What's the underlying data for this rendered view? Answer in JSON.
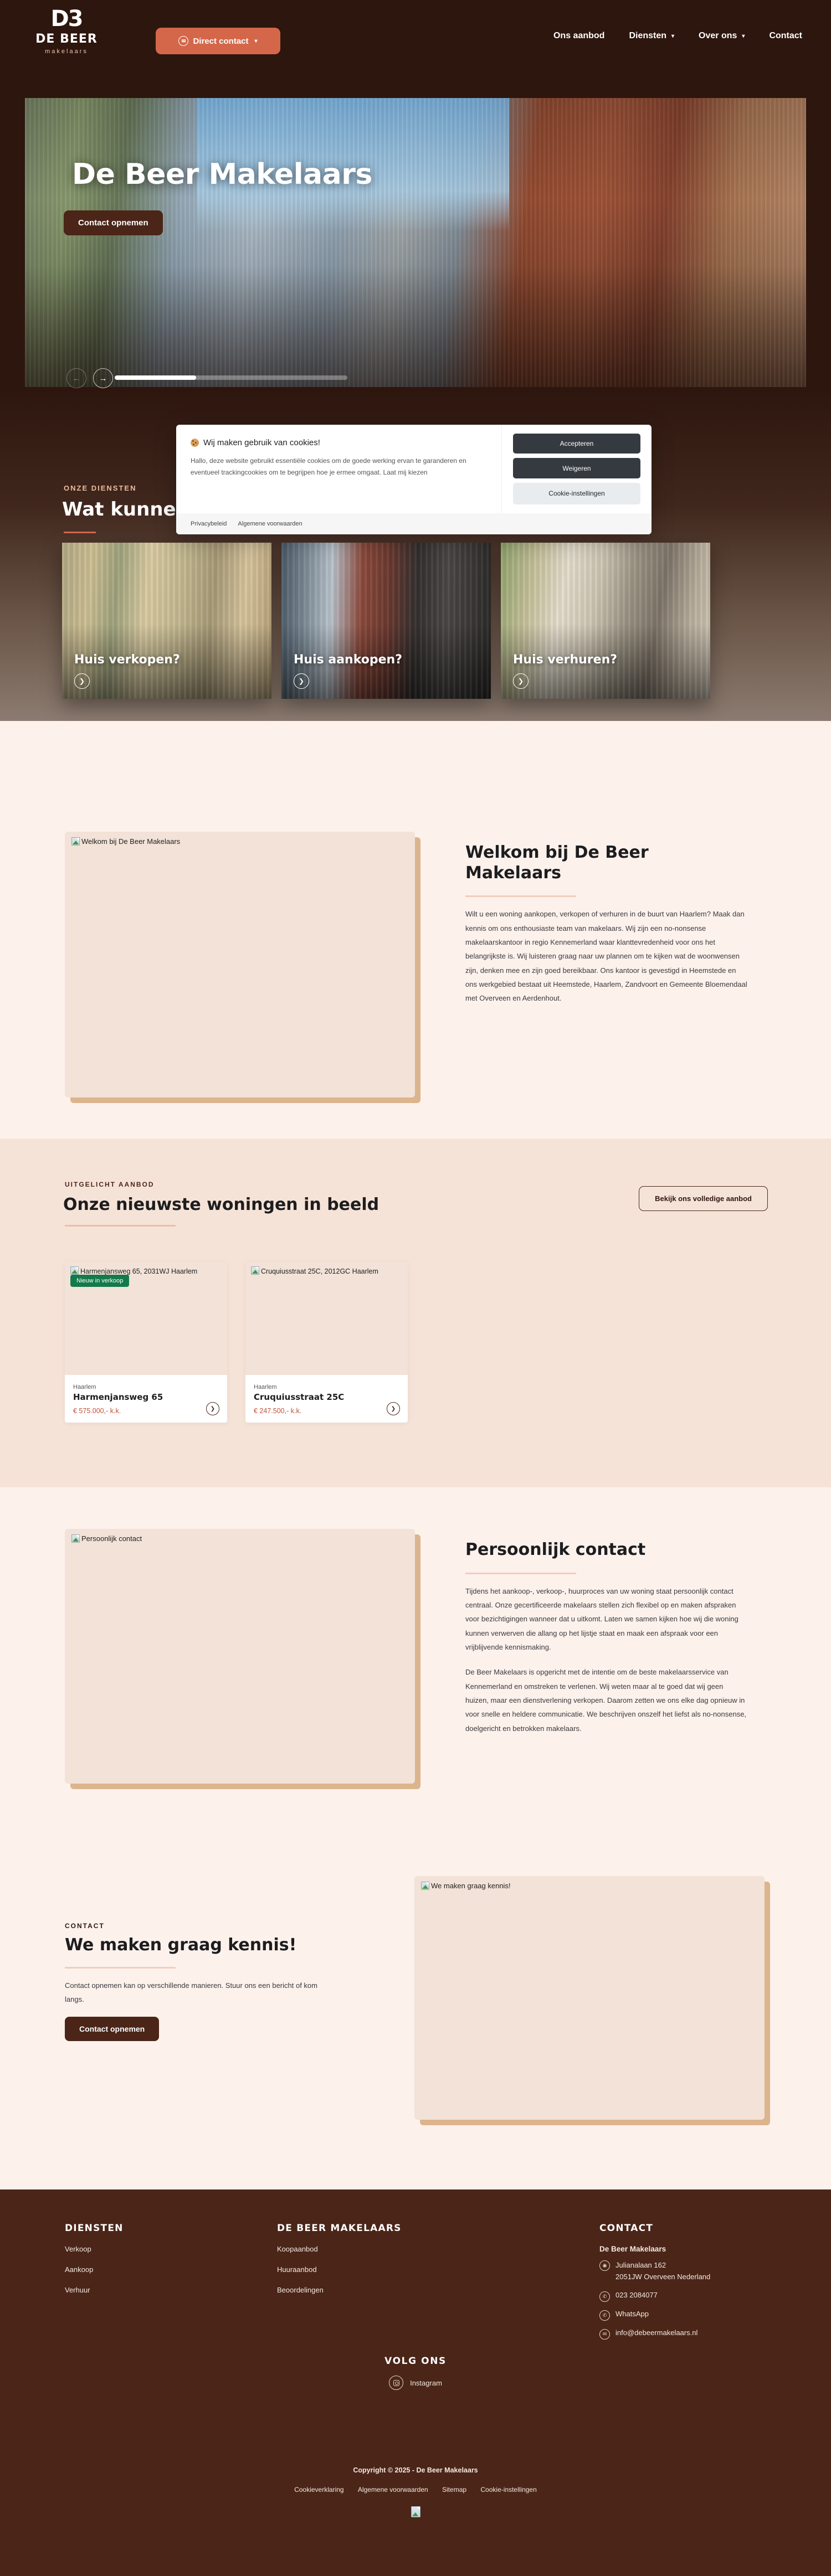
{
  "header": {
    "logo_mark": "D3",
    "logo_name": "DE BEER",
    "logo_sub": "makelaars",
    "direct_contact_label": "Direct contact",
    "direct_contact_icon": "envelope-icon",
    "nav": [
      {
        "label": "Ons aanbod",
        "has_chevron": false
      },
      {
        "label": "Diensten",
        "has_chevron": true
      },
      {
        "label": "Over ons",
        "has_chevron": true
      },
      {
        "label": "Contact",
        "has_chevron": false
      }
    ]
  },
  "hero": {
    "title": "De Beer Makelaars",
    "cta_label": "Contact opnemen",
    "prev_icon": "arrow-left-icon",
    "next_icon": "arrow-right-icon",
    "progress_percent": "35"
  },
  "cookie": {
    "icon": "cookie-icon",
    "title": "Wij maken gebruik van cookies!",
    "body": "Hallo, deze website gebruikt essentiële cookies om de goede werking ervan te garanderen en eventueel trackingcookies om te begrijpen hoe je ermee omgaat. Laat mij kiezen",
    "accept_label": "Accepteren",
    "decline_label": "Weigeren",
    "settings_label": "Cookie-instellingen",
    "privacy_label": "Privacybeleid",
    "terms_label": "Algemene voorwaarden"
  },
  "services": {
    "eyebrow": "ONZE DIENSTEN",
    "title": "Wat kunnen wij voor u doen?",
    "cards": [
      {
        "label": "Huis verkopen?",
        "arrow_icon": "chevron-right-icon"
      },
      {
        "label": "Huis aankopen?",
        "arrow_icon": "chevron-right-icon"
      },
      {
        "label": "Huis verhuren?",
        "arrow_icon": "chevron-right-icon"
      }
    ]
  },
  "welkom": {
    "image_alt": "Welkom bij De Beer Makelaars",
    "title": "Welkom bij De Beer Makelaars",
    "body": "Wilt u een woning aankopen, verkopen of verhuren in de buurt van Haarlem? Maak dan kennis om ons enthousiaste team van makelaars. Wij zijn een no-nonsense makelaarskantoor in regio Kennemerland waar klanttevredenheid voor ons het belangrijkste is. Wij luisteren graag naar uw plannen om te kijken wat de woonwensen zijn, denken mee en zijn goed bereikbaar. Ons kantoor is gevestigd in Heemstede en ons werkgebied bestaat uit Heemstede, Haarlem, Zandvoort en Gemeente Bloemendaal met Overveen en Aerdenhout."
  },
  "aanbod": {
    "eyebrow": "UITGELICHT AANBOD",
    "title": "Onze nieuwste woningen in beeld",
    "cta_label": "Bekijk ons volledige aanbod",
    "listings": [
      {
        "image_alt": "Harmenjansweg 65, 2031WJ Haarlem",
        "badge": "Nieuw in verkoop",
        "city": "Haarlem",
        "street": "Harmenjansweg 65",
        "price": "€ 575.000,- k.k.",
        "arrow_icon": "chevron-right-icon"
      },
      {
        "image_alt": "Cruquiusstraat 25C, 2012GC Haarlem",
        "badge": "",
        "city": "Haarlem",
        "street": "Cruquiusstraat 25C",
        "price": "€ 247.500,- k.k.",
        "arrow_icon": "chevron-right-icon"
      }
    ]
  },
  "persoonlijk": {
    "image_alt": "Persoonlijk contact",
    "title": "Persoonlijk contact",
    "body1": "Tijdens het aankoop-, verkoop-, huurproces van uw woning staat persoonlijk contact centraal. Onze gecertificeerde makelaars stellen zich flexibel op en maken afspraken voor bezichtigingen wanneer dat u uitkomt. Laten we samen kijken hoe wij die woning kunnen verwerven die allang op het lijstje staat en maak een afspraak voor een vrijblijvende kennismaking.",
    "body2": "De Beer Makelaars is opgericht met de intentie om de beste makelaarsservice van Kennemerland en omstreken te verlenen. Wij weten maar al te goed dat wij geen huizen, maar een dienstverlening verkopen. Daarom zetten we ons elke dag opnieuw in voor snelle en heldere communicatie. We beschrijven onszelf het liefst als no-nonsense, doelgericht en betrokken makelaars."
  },
  "kennis": {
    "image_alt": "We maken graag kennis!",
    "eyebrow": "CONTACT",
    "title": "We maken graag kennis!",
    "body": "Contact opnemen kan op verschillende manieren. Stuur ons een bericht of kom langs.",
    "cta_label": "Contact opnemen"
  },
  "footer": {
    "diensten": {
      "heading": "DIENSTEN",
      "links": [
        "Verkoop",
        "Aankoop",
        "Verhuur"
      ]
    },
    "makelaars": {
      "heading": "DE BEER MAKELAARS",
      "links": [
        "Koopaanbod",
        "Huuraanbod",
        "Beoordelingen"
      ]
    },
    "contact": {
      "heading": "CONTACT",
      "company": "De Beer Makelaars",
      "address_line1": "Julianalaan 162",
      "address_line2": "2051JW Overveen Nederland",
      "address_icon": "map-pin-icon",
      "phone": "023 2084077",
      "phone_icon": "phone-icon",
      "whatsapp": "WhatsApp",
      "whatsapp_icon": "whatsapp-icon",
      "email": "info@debeermakelaars.nl",
      "email_icon": "envelope-icon"
    },
    "volg_ons": {
      "heading": "VOLG ONS",
      "instagram_label": "Instagram",
      "instagram_icon": "instagram-icon"
    },
    "copyright": "Copyright © 2025 - De Beer Makelaars",
    "legal_links": [
      "Cookieverklaring",
      "Algemene voorwaarden",
      "Sitemap",
      "Cookie-instellingen"
    ]
  },
  "colors": {
    "brand_dark": "#2d160e",
    "brand_brown": "#4a2518",
    "accent_orange": "#d4674a",
    "cream": "#fdf1ec",
    "cream_dark": "#f6e3d8",
    "badge_green": "#137a4b",
    "price_red": "#c0543a"
  }
}
